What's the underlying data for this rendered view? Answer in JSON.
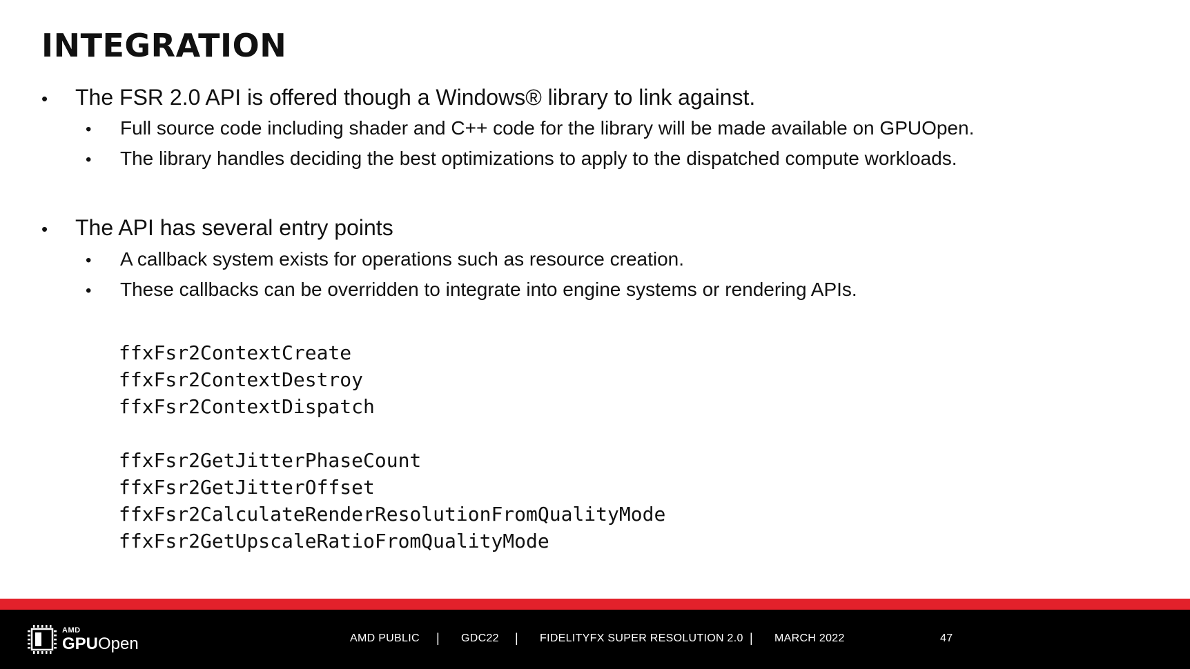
{
  "slide": {
    "title": "INTEGRATION",
    "sections": [
      {
        "text": "The FSR 2.0 API is offered though a Windows® library to link against.",
        "subitems": [
          "Full source code including shader and C++ code for the library will be made available on GPUOpen.",
          "The library handles deciding the best optimizations to apply to the dispatched compute workloads."
        ]
      },
      {
        "text": "The API has several entry points",
        "subitems": [
          "A callback system exists for operations such as resource creation.",
          "These callbacks can be overridden to integrate into engine systems or rendering APIs."
        ]
      }
    ],
    "bullet_glyph": "•",
    "code_lines": [
      "ffxFsr2ContextCreate",
      "ffxFsr2ContextDestroy",
      "ffxFsr2ContextDispatch",
      "",
      "ffxFsr2GetJitterPhaseCount",
      "ffxFsr2GetJitterOffset",
      "ffxFsr2CalculateRenderResolutionFromQualityMode",
      "ffxFsr2GetUpscaleRatioFromQualityMode"
    ]
  },
  "footer": {
    "logo_small": "AMD",
    "logo_main_bold": "GPU",
    "logo_main_light": "Open",
    "classification": "AMD PUBLIC",
    "event": "GDC22",
    "topic": "FIDELITYFX SUPER RESOLUTION 2.0",
    "date": "MARCH 2022",
    "page_number": "47",
    "separator": "|"
  },
  "colors": {
    "accent_red": "#e3212b",
    "footer_bg": "#000000",
    "text": "#111111"
  },
  "icons": {
    "logo": "amd-chip-icon"
  }
}
